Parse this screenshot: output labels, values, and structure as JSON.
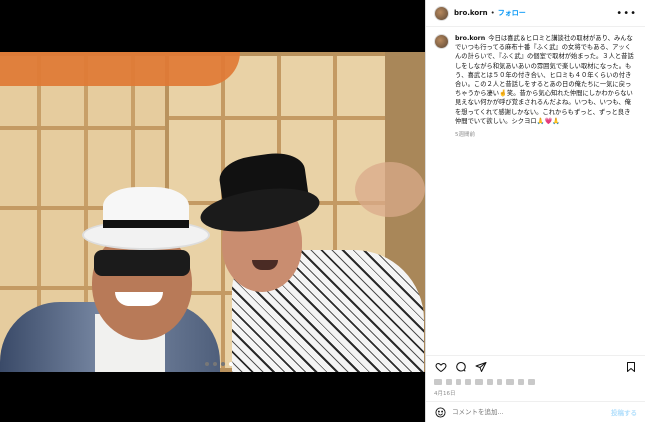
{
  "header": {
    "username": "bro.korn",
    "separator": "•",
    "follow_label": "フォロー",
    "more_label": "•••"
  },
  "caption": {
    "username": "bro.korn",
    "text": "今日は喜武＆ヒロミと講談社の取材があり、みんなでいつも行ってる麻布十番『ふく武』の女将でもある、アッくんの計らいで、『ふく武』の個室で取材が始まった。３人と昔話しをしながら和気あいあいの雰囲気で楽しい取材になった。もう、喜武とは５０年の付き合い、ヒロミも４０年くらいの付き合い。この２人と昔話しをするとあの日の俺たちに一気に戻っちゃうから凄い🤞笑。昔から気心知れた仲間にしかわからない見えない何かが呼び覚まされるんだよね。いつも、いつも、俺を想ってくれて感謝しかない。これからもずっと、ずっと良き仲間でいて欲しい。シクヨロ🙏💗🙏",
    "time_ago": "5週間前"
  },
  "actions": {
    "like_icon": "heart-icon",
    "comment_icon": "comment-icon",
    "share_icon": "share-icon",
    "save_icon": "bookmark-icon"
  },
  "post_date": "4月16日",
  "comment_bar": {
    "placeholder": "コメントを追加...",
    "post_label": "投稿する"
  },
  "colors": {
    "accent": "#0095f6",
    "muted": "#8e8e8e",
    "post_disabled": "#b2dffc"
  },
  "carousel": {
    "count": 4,
    "active_index": 3
  }
}
